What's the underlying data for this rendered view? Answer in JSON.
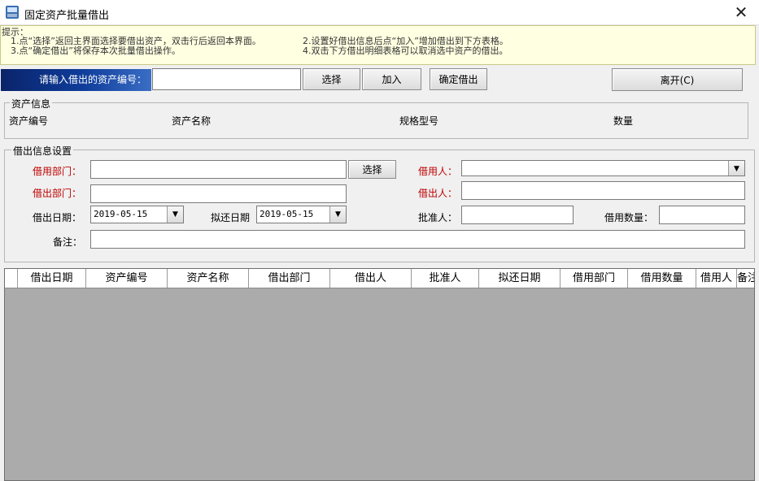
{
  "window": {
    "title": "固定资产批量借出",
    "close": "✕"
  },
  "hint": {
    "label": "提示：",
    "line1": "1.点“选择”返回主界面选择要借出资产，双击行后返回本界面。",
    "line2": "2.设置好借出信息后点“加入”增加借出到下方表格。",
    "line3": "3.点“确定借出”将保存本次批量借出操作。",
    "line4": "4.双击下方借出明细表格可以取消选中资产的借出。"
  },
  "top": {
    "asset_label": "请输入借出的资产编号：",
    "asset_value": "",
    "select_button": "选择",
    "add_button": "加入",
    "confirm_button": "确定借出",
    "leave_button": "离开(C)"
  },
  "asset_info": {
    "title": "资产信息",
    "code": "资产编号",
    "name": "资产名称",
    "spec": "规格型号",
    "qty": "数量"
  },
  "lend": {
    "title": "借出信息设置",
    "borrow_dept": "借用部门：",
    "borrow_dept_select": "选择",
    "borrower": "借用人：",
    "lend_dept": "借出部门：",
    "lender": "借出人：",
    "lend_date": "借出日期：",
    "lend_date_value": "2019-05-15",
    "return_date": "拟还日期",
    "return_date_value": "2019-05-15",
    "approver": "批准人：",
    "borrow_qty": "借用数量：",
    "remark": "备注："
  },
  "grid": {
    "columns": [
      "借出日期",
      "资产编号",
      "资产名称",
      "借出部门",
      "借出人",
      "批准人",
      "拟还日期",
      "借用部门",
      "借用数量",
      "借用人",
      "备注"
    ]
  }
}
